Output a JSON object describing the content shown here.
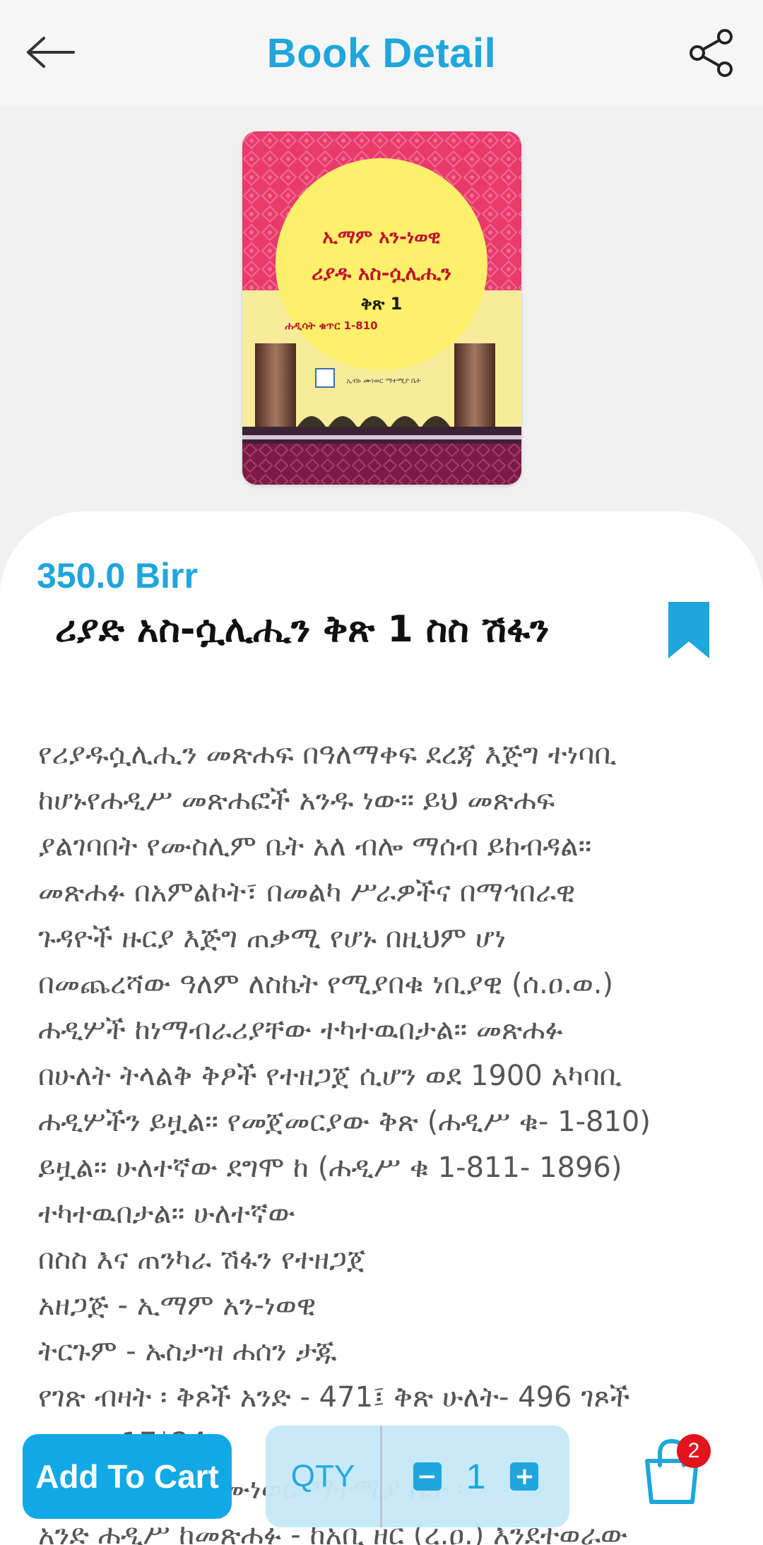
{
  "header": {
    "title": "Book Detail",
    "back_icon": "arrow-left-icon",
    "share_icon": "share-icon"
  },
  "cover": {
    "line1": "ኢማም አን-ነወዊ",
    "line2": "ሪያዱ አስ-ሷሊሒን",
    "line3": "ቅጽ 1",
    "line4": "ሐዲሳት ቁጥር 1-810",
    "publisher": "ኢብኑ ሙነወር ማተሚያ ቤት"
  },
  "book": {
    "price": "350.0 Birr",
    "title": "ሪያድ አስ-ሷሊሒን ቅጽ 1 ስስ ሽፋን",
    "bookmark_icon": "bookmark-icon"
  },
  "description": [
    "የሪያዱሷሊሒን መጽሐፍ በዓለማቀፍ ደረጃ እጅግ ተነባቢ",
    "ከሆኑየሐዲሥ መጽሐፎች አንዱ ነው። ይህ መጽሐፍ",
    "ያልገባበት የሙስሊም ቤት አለ ብሎ ማሰብ ይከብዳል።",
    "መጽሐፉ በአምልኮት፣ በመልካ ሥራዎችና በማኅበራዊ",
    "ጉዳዮች ዙርያ እጅግ ጠቃሚ የሆኑ በዚህም ሆነ",
    "በመጨረሻው ዓለም ለስኬት የሚያበቁ ነቢያዊ (ሰ.ዐ.ወ.)",
    "ሐዲሦች ከነማብራሪያቸው ተካተዉበታል። መጽሐፉ",
    "በሁለት ትላልቅ ቅፆች የተዘጋጀ ሲሆን ወደ 1900 አካባቢ",
    "ሐዲሦችን ይዟል። የመጀመርያው ቅጽ (ሐዲሥ ቁ- 1-810)",
    "ይዟል። ሁለተኛው ደግሞ ከ (ሐዲሥ ቁ 1-811- 1896)",
    "ተካተዉበታል። ሁለተኛው",
    "በስስ እና ጠንካራ ሽፋን የተዘጋጀ",
    "አዘጋጅ - ኢማም አን-ነወዊ",
    "ትርጉም - ኡስታዝ ሐሰን ታጁ",
    "የገጽ ብዛት ፡ ቅጾች አንድ - 471፤ ቅጽ ሁለት- 496 ገጾች",
    "መጠን- 17*24",
    "አሳታሚ - ኢብኑ ሙነወር ማተሚያ ቤት ፡",
    "አንድ ሐዲሥ ከመጽሐፉ - ከአቢ ዘር (ረ.ዐ.) እንደተወራው"
  ],
  "bottom_bar": {
    "add_to_cart": "Add To Cart",
    "qty_label": "QTY",
    "decrement": "−",
    "quantity": "1",
    "increment": "+",
    "cart_icon": "shopping-bag-icon",
    "cart_count": "2"
  },
  "colors": {
    "accent": "#1fa6dc",
    "button": "#10a9e5",
    "badge": "#e3141d"
  }
}
